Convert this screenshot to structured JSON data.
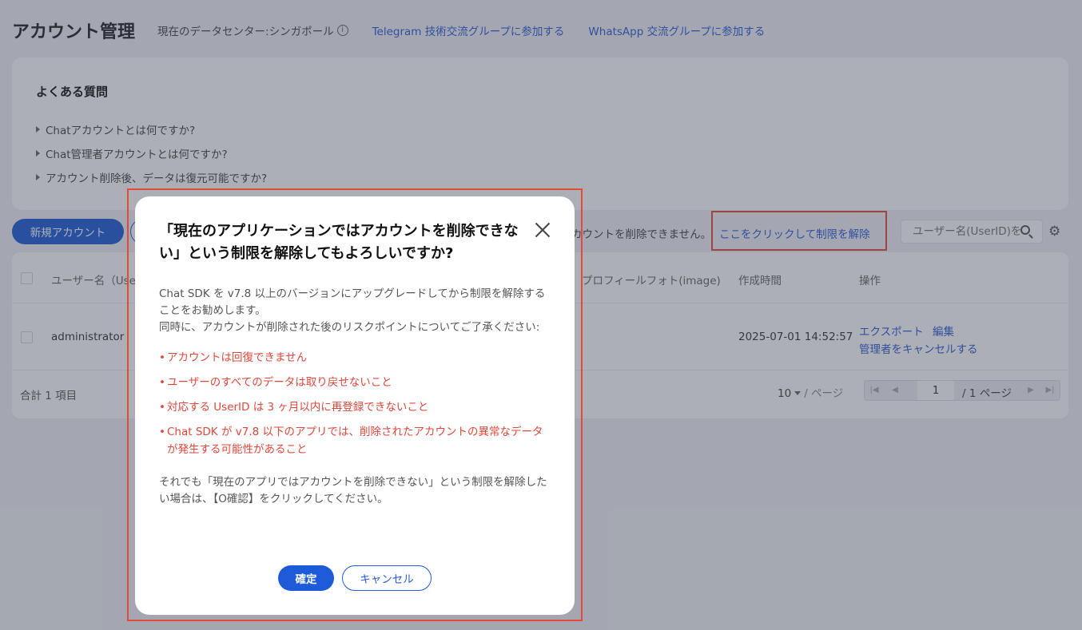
{
  "header": {
    "title": "アカウント管理",
    "data_center": "現在のデータセンター:シンガポール",
    "telegram_link": "Telegram 技術交流グループに参加する",
    "whatsapp_link": "WhatsApp 交流グループに参加する"
  },
  "faq": {
    "title": "よくある質問",
    "items": [
      "Chatアカウントとは何ですか?",
      "Chat管理者アカウントとは何ですか?",
      "アカウント削除後、データは復元可能ですか?"
    ]
  },
  "toolbar": {
    "new_account": "新規アカウント",
    "notice_partial": "カウントを削除できません。",
    "unlock_link": "ここをクリックして制限を解除",
    "search_placeholder": "ユーザー名(UserID)を検索"
  },
  "table": {
    "columns": {
      "username": "ユーザー名（Use",
      "profile_photo": "プロフィールフォト(image)",
      "created": "作成時間",
      "actions": "操作"
    },
    "rows": [
      {
        "username": "administrator",
        "created": "2025-07-01 14:52:57",
        "action_export": "エクスポート",
        "action_edit": "編集",
        "action_cancel_admin": "管理者をキャンセルする"
      }
    ],
    "total": "合計 1 項目",
    "page_size": "10",
    "per_page": "/ ページ",
    "current_page": "1",
    "total_pages": "/ 1 ページ"
  },
  "modal": {
    "title": "「現在のアプリケーションではアカウントを削除できない」という制限を解除してもよろしいですか?",
    "para1": "Chat SDK を v7.8 以上のバージョンにアップグレードしてから制限を解除することをお勧めします。",
    "para2": "同時に、アカウントが削除された後のリスクポイントについてご了承ください:",
    "risks": [
      "アカウントは回復できません",
      "ユーザーのすべてのデータは取り戻せないこと",
      "対応する UserID は 3 ヶ月以内に再登録できないこと",
      "Chat SDK が v7.8 以下のアプリでは、削除されたアカウントの異常なデータが発生する可能性があること"
    ],
    "closing": "それでも「現在のアプリではアカウントを削除できない」という制限を解除したい場合は、【O確認】をクリックしてください。",
    "confirm": "確定",
    "cancel": "キャンセル"
  },
  "colors": {
    "primary": "#1d5bd8",
    "link": "#2a5bd7",
    "danger": "#e0473a",
    "highlight_border": "#e5493a"
  }
}
